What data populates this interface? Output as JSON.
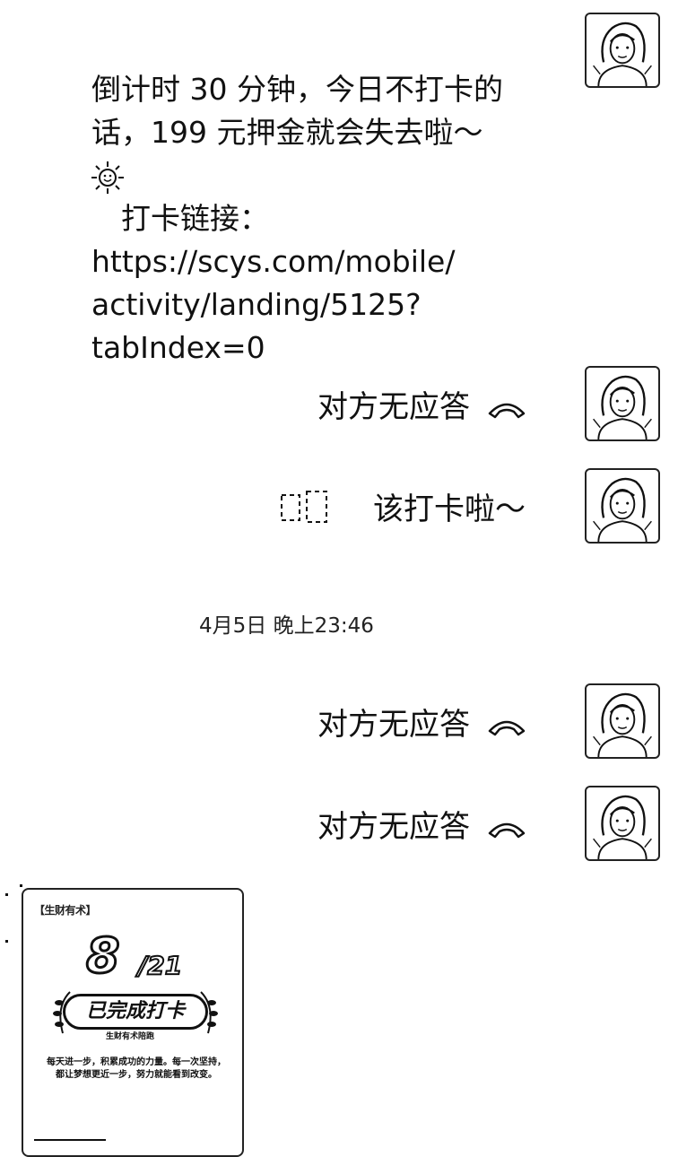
{
  "messages": [
    {
      "type": "text",
      "text": "倒计时 30 分钟，今日不打卡的\n话，199 元押金就会失去啦～\n\n打卡链接：\nhttps://scys.com/mobile/\nactivity/landing/5125?\ntabIndex=0",
      "link_prefix_icon": "sun-emoji-icon",
      "avatar": "woman-avatar-icon"
    },
    {
      "type": "call",
      "text": "对方无应答",
      "icon": "phone-hangup-icon",
      "avatar": "woman-avatar-icon"
    },
    {
      "type": "text",
      "text": "该打卡啦～",
      "prefix_icon": "broken-image-icon",
      "avatar": "woman-avatar-icon"
    },
    {
      "type": "call",
      "text": "对方无应答",
      "icon": "phone-hangup-icon",
      "avatar": "woman-avatar-icon"
    },
    {
      "type": "call",
      "text": "对方无应答",
      "icon": "phone-hangup-icon",
      "avatar": "woman-avatar-icon"
    }
  ],
  "timestamp": "4月5日 晚上23:46",
  "card": {
    "header": "【生财有术】",
    "day": "8",
    "total": "/21",
    "status": "已完成打卡",
    "sub": "生财有术陪跑",
    "quote": "每天进一步，积累成功的力量。每一次坚持，都让梦想更近一步，努力就能看到改变。"
  },
  "colors": {
    "background": "#ffffff",
    "text": "#111111"
  }
}
